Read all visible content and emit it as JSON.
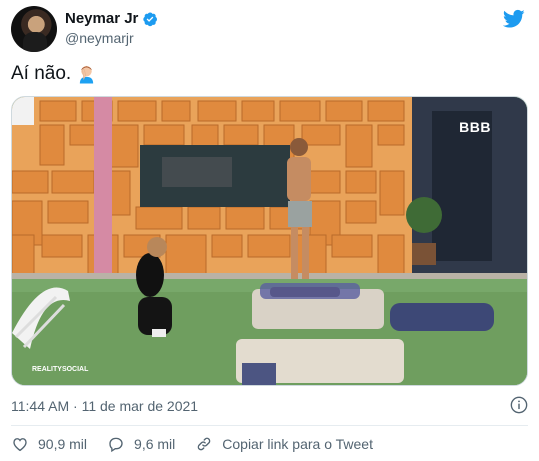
{
  "author": {
    "name": "Neymar Jr",
    "handle": "@neymarjr",
    "verified_icon": "verified-badge-icon",
    "avatar_icon": "avatar"
  },
  "tweet": {
    "text": "Aí não.",
    "emoji_icon": "facepalm-icon"
  },
  "media": {
    "watermark_logo": "BBB",
    "watermark_social": "REALITYSOCIAL"
  },
  "meta": {
    "time": "11:44 AM",
    "separator": "·",
    "date": "11 de mar de 2021"
  },
  "actions": {
    "likes": "90,9 mil",
    "replies": "9,6 mil",
    "copy_link": "Copiar link para o Tweet"
  },
  "colors": {
    "twitter_blue": "#1d9bf0",
    "text_primary": "#0f1419",
    "text_secondary": "#536471"
  }
}
